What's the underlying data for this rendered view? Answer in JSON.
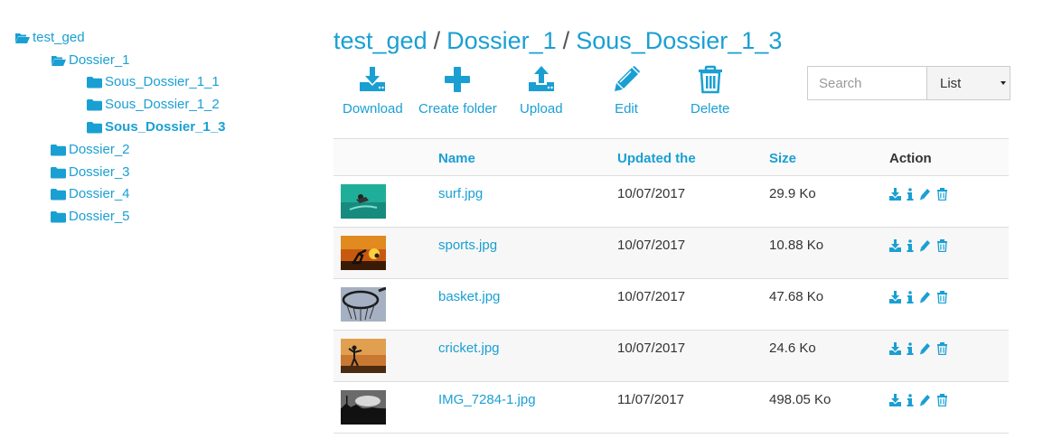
{
  "tree": {
    "root": "test_ged",
    "items": [
      {
        "label": "Dossier_1"
      },
      {
        "label": "Sous_Dossier_1_1"
      },
      {
        "label": "Sous_Dossier_1_2"
      },
      {
        "label": "Sous_Dossier_1_3"
      },
      {
        "label": "Dossier_2"
      },
      {
        "label": "Dossier_3"
      },
      {
        "label": "Dossier_4"
      },
      {
        "label": "Dossier_5"
      }
    ]
  },
  "breadcrumb": {
    "items": [
      "test_ged",
      "Dossier_1",
      "Sous_Dossier_1_3"
    ],
    "separator": "/"
  },
  "toolbar": {
    "download": "Download",
    "create_folder": "Create folder",
    "upload": "Upload",
    "edit": "Edit",
    "delete": "Delete"
  },
  "search": {
    "placeholder": "Search"
  },
  "view": {
    "selected": "List"
  },
  "table": {
    "headers": {
      "name": "Name",
      "updated": "Updated the",
      "size": "Size",
      "action": "Action"
    },
    "rows": [
      {
        "name": "surf.jpg",
        "updated": "10/07/2017",
        "size": "29.9 Ko"
      },
      {
        "name": "sports.jpg",
        "updated": "10/07/2017",
        "size": "10.88 Ko"
      },
      {
        "name": "basket.jpg",
        "updated": "10/07/2017",
        "size": "47.68 Ko"
      },
      {
        "name": "cricket.jpg",
        "updated": "10/07/2017",
        "size": "24.6 Ko"
      },
      {
        "name": "IMG_7284-1.jpg",
        "updated": "11/07/2017",
        "size": "498.05 Ko"
      }
    ]
  },
  "colors": {
    "accent": "#1a9fd3",
    "text": "#333333",
    "border": "#dddddd",
    "row_alt": "#f7f7f7"
  },
  "icons": {
    "tree_open": "folder-open-icon",
    "tree_closed": "folder-icon",
    "actions": [
      "download-icon",
      "info-icon",
      "pencil-icon",
      "trash-icon"
    ]
  }
}
